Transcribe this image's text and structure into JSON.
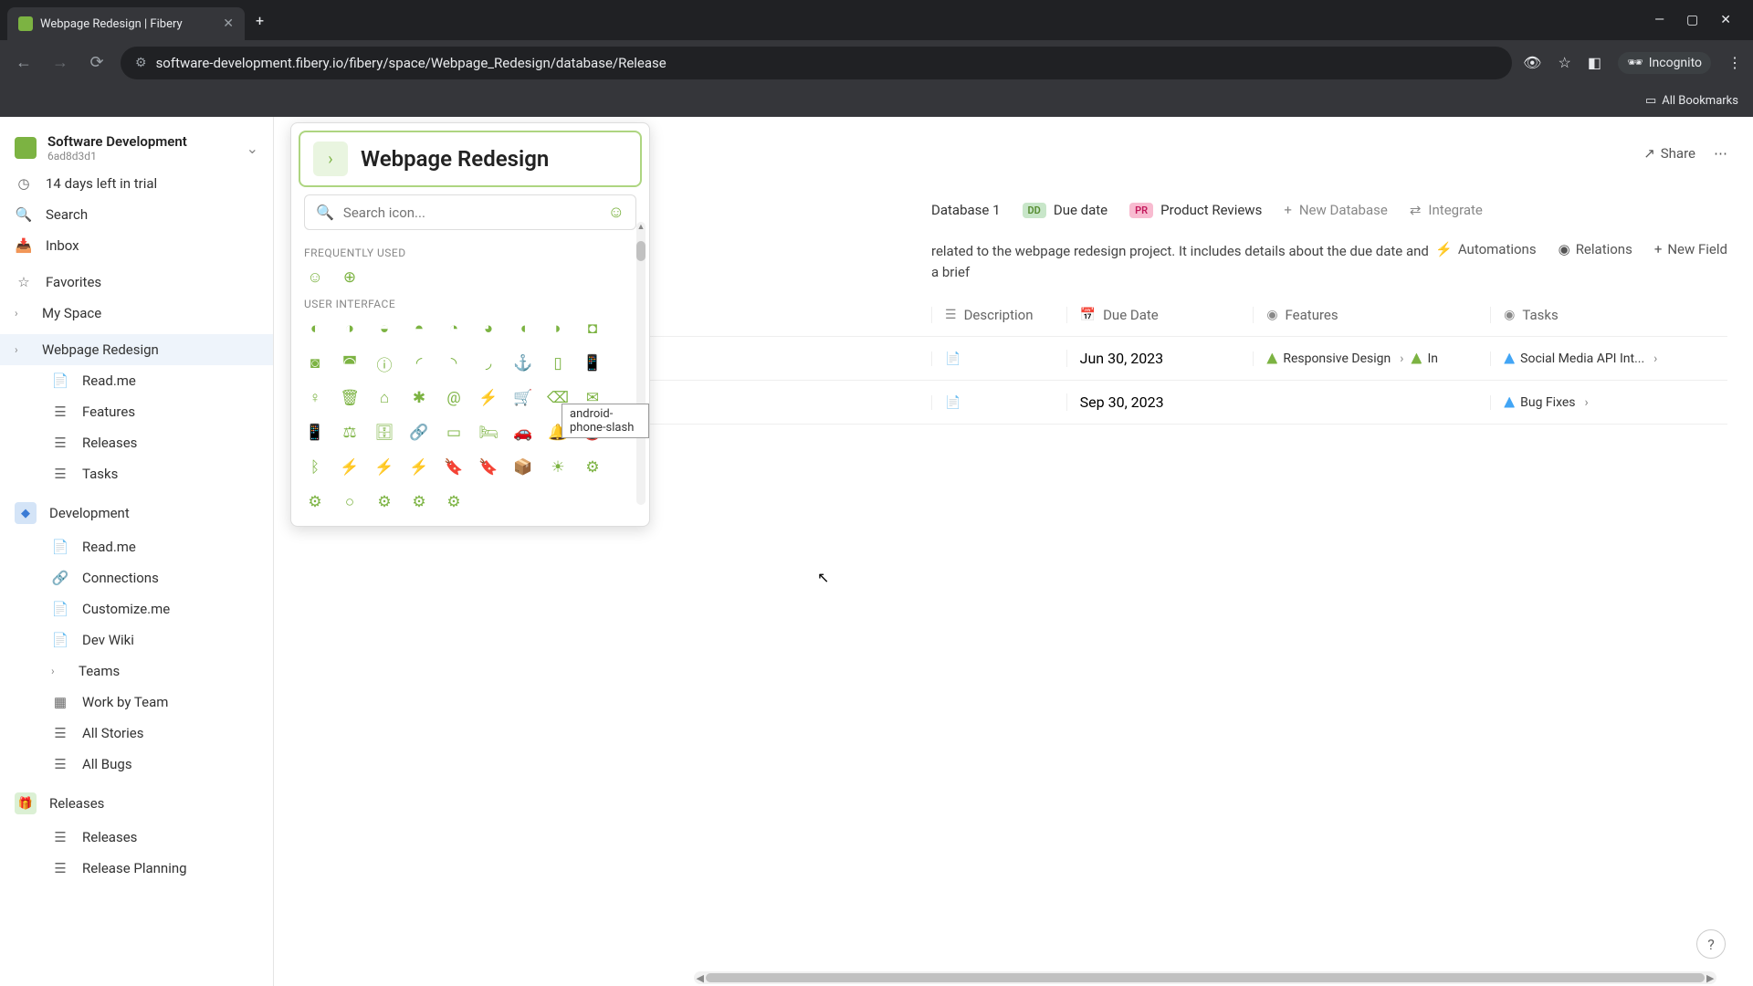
{
  "browser": {
    "tab_title": "Webpage Redesign | Fibery",
    "url": "software-development.fibery.io/fibery/space/Webpage_Redesign/database/Release",
    "incognito_label": "Incognito",
    "all_bookmarks": "All Bookmarks"
  },
  "workspace": {
    "name": "Software Development",
    "id": "6ad8d3d1"
  },
  "sidebar": {
    "trial": "14 days left in trial",
    "search": "Search",
    "inbox": "Inbox",
    "favorites": "Favorites",
    "my_space": "My Space",
    "spaces": [
      {
        "name": "Webpage Redesign",
        "active": true,
        "children": [
          "Read.me",
          "Features",
          "Releases",
          "Tasks"
        ]
      },
      {
        "name": "Development",
        "children": [
          "Read.me",
          "Connections",
          "Customize.me",
          "Dev Wiki",
          "Teams",
          "Work by Team",
          "All Stories",
          "All Bugs"
        ]
      },
      {
        "name": "Releases",
        "children": [
          "Releases",
          "Release Planning"
        ]
      }
    ]
  },
  "page": {
    "title": "Webpage Redesign",
    "share": "Share"
  },
  "db_tabs": {
    "d1": "Database 1",
    "dd": "Due date",
    "pr": "Product Reviews",
    "new_db": "New Database",
    "integrate": "Integrate"
  },
  "content": {
    "description_fragment": "related to the webpage redesign project. It includes details about the due date and a brief",
    "automations": "Automations",
    "relations": "Relations",
    "new_field": "New Field"
  },
  "table": {
    "headers": {
      "description": "Description",
      "due_date": "Due Date",
      "features": "Features",
      "tasks": "Tasks"
    },
    "rows": [
      {
        "due_date": "Jun 30, 2023",
        "features": [
          {
            "name": "Responsive Design"
          },
          {
            "name": "In"
          }
        ],
        "tasks": [
          {
            "name": "Social Media API Int..."
          }
        ]
      },
      {
        "due_date": "Sep 30, 2023",
        "features": [],
        "tasks": [
          {
            "name": "Bug Fixes"
          }
        ]
      }
    ],
    "add_row_placeholder": ""
  },
  "icon_picker": {
    "header_title": "Webpage Redesign",
    "search_placeholder": "Search icon...",
    "section_frequent": "Frequently Used",
    "section_ui": "User Interface",
    "tooltip": "android-phone-slash",
    "frequent_icons": [
      "☺",
      "⊕"
    ],
    "ui_icons": [
      "◐",
      "◑",
      "◒",
      "◓",
      "◔",
      "◕",
      "◖",
      "◗",
      "◘",
      "◙",
      "◚",
      "ⓘ",
      "◜",
      "◝",
      "◞",
      "⚓",
      "▯",
      "📱",
      "♀",
      "🗑",
      "⌂",
      "✱",
      "@",
      "⚡",
      "🛒",
      "⌫",
      "✉",
      "📱",
      "⚖",
      "🗄",
      "🔗",
      "▭",
      "🛏",
      "🚗",
      "🔔",
      "🔕",
      "ᛒ",
      "⚡",
      "⚡",
      "⚡",
      "🔖",
      "🔖",
      "📦",
      "☀",
      "⚙",
      "⚙",
      "○",
      "⚙",
      "⚙",
      "⚙"
    ]
  },
  "help": "?"
}
